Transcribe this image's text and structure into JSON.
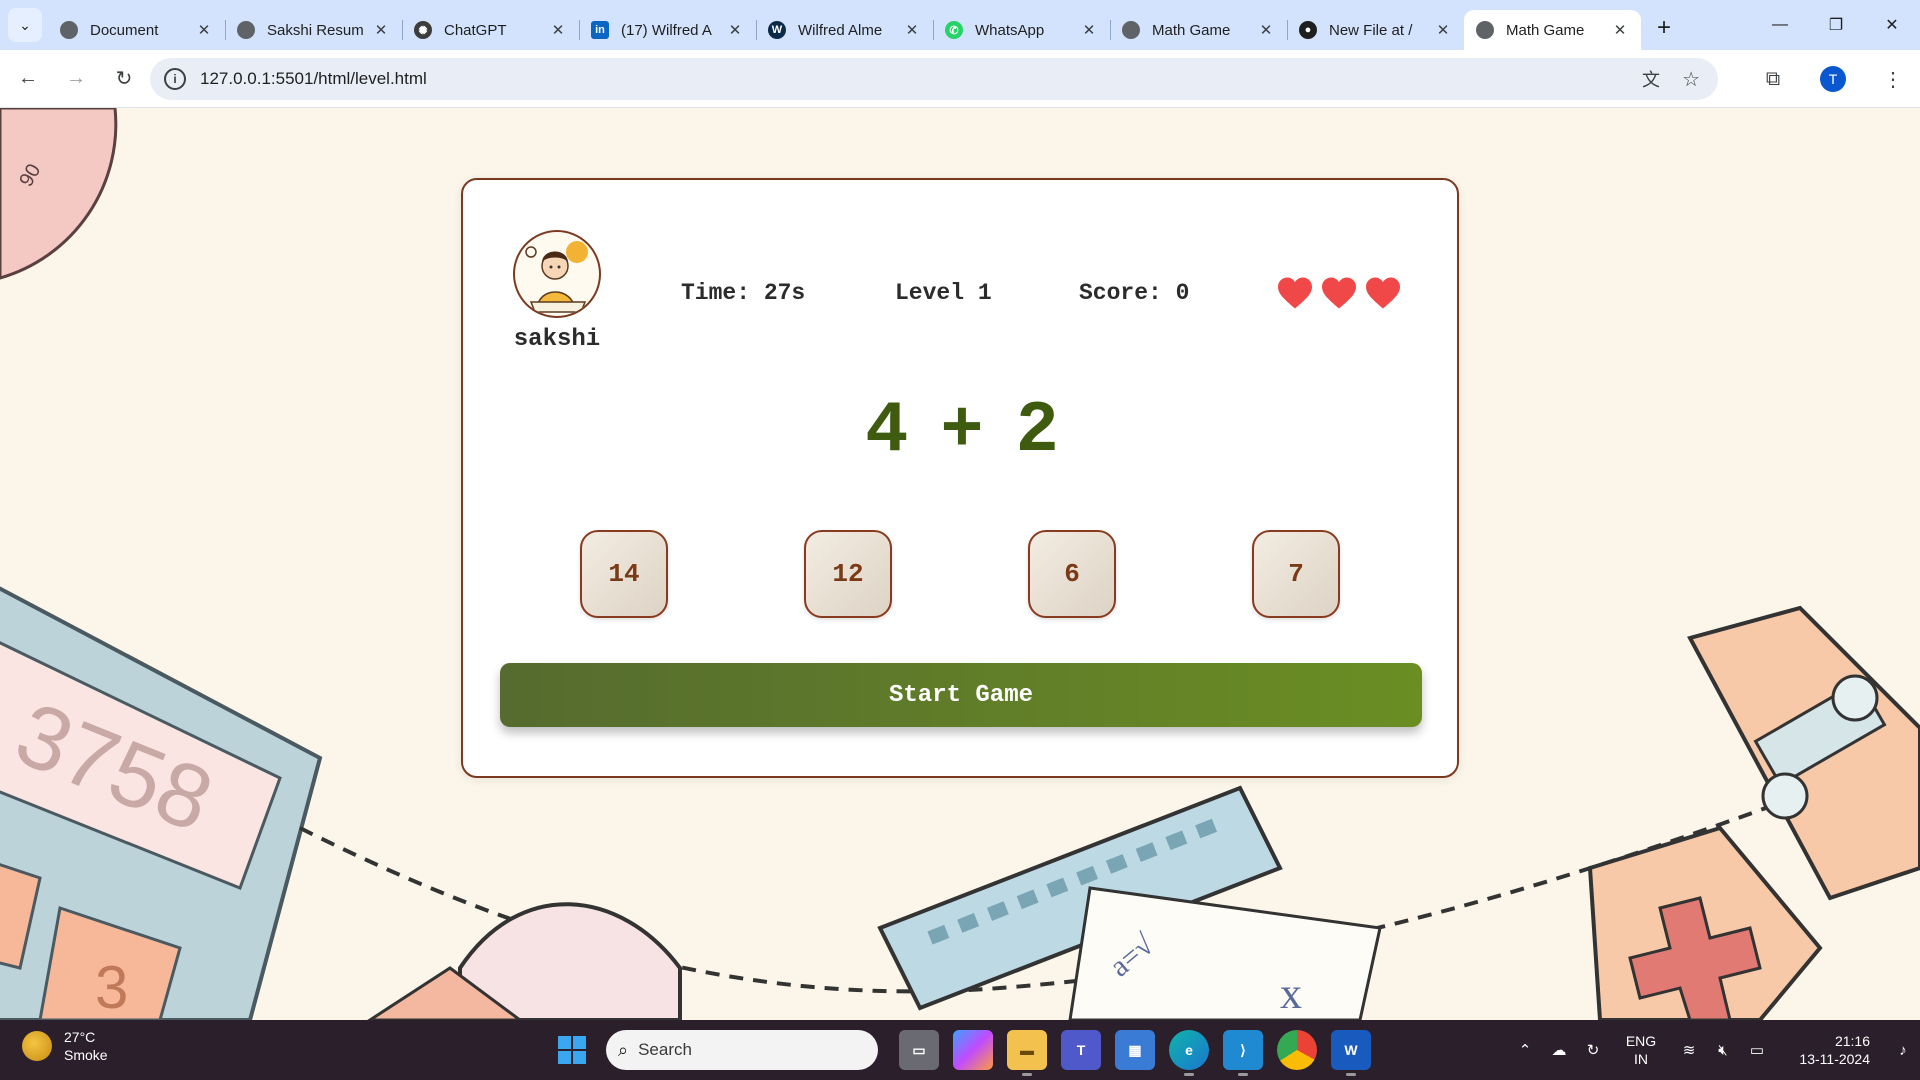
{
  "browser": {
    "tabs": [
      {
        "label": "Document",
        "favicon": "globe-icon",
        "active": false
      },
      {
        "label": "Sakshi Resum",
        "favicon": "globe-icon",
        "active": false
      },
      {
        "label": "ChatGPT",
        "favicon": "chatgpt-icon",
        "active": false
      },
      {
        "label": "(17) Wilfred A",
        "favicon": "linkedin-icon",
        "active": false
      },
      {
        "label": "Wilfred Alme",
        "favicon": "w-icon",
        "active": false
      },
      {
        "label": "WhatsApp",
        "favicon": "whatsapp-icon",
        "active": false
      },
      {
        "label": "Math Game",
        "favicon": "globe-icon",
        "active": false
      },
      {
        "label": "New File at /",
        "favicon": "github-icon",
        "active": false
      },
      {
        "label": "Math Game",
        "favicon": "globe-icon",
        "active": true
      }
    ],
    "url": "127.0.0.1:5501/html/level.html",
    "profile_initial": "T"
  },
  "game": {
    "player_name": "sakshi",
    "time_text": "Time: 27s",
    "level_text": "Level 1",
    "score_text": "Score: 0",
    "lives": 3,
    "equation": {
      "left": "4",
      "operator": "+",
      "right": "2"
    },
    "options": [
      "14",
      "12",
      "6",
      "7"
    ],
    "start_button": "Start Game",
    "colors": {
      "accent": "#6b8e23",
      "border": "#7a3a22",
      "heart": "#f04848",
      "equation": "#3f5b10"
    }
  },
  "taskbar": {
    "weather_temp": "27°C",
    "weather_desc": "Smoke",
    "search_placeholder": "Search",
    "lang_line1": "ENG",
    "lang_line2": "IN",
    "time": "21:16",
    "date": "13-11-2024"
  }
}
